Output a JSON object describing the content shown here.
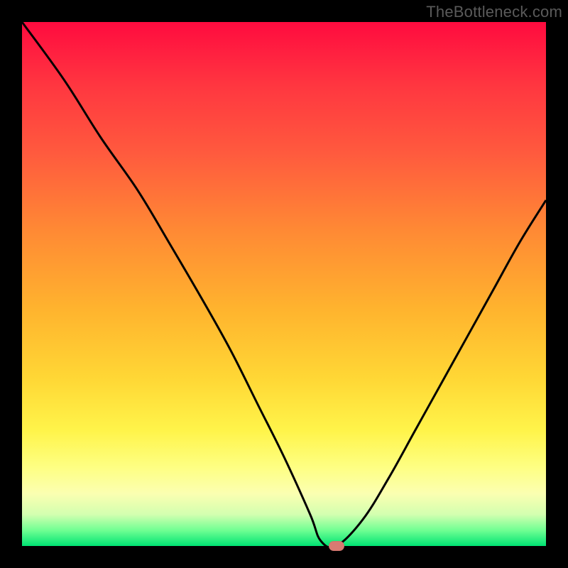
{
  "watermark": "TheBottleneck.com",
  "colors": {
    "curve_stroke": "#000000",
    "marker_fill": "#d97a72",
    "frame_bg": "#000000"
  },
  "chart_data": {
    "type": "line",
    "title": "",
    "xlabel": "",
    "ylabel": "",
    "xlim": [
      0,
      100
    ],
    "ylim": [
      0,
      100
    ],
    "series": [
      {
        "name": "bottleneck_curve",
        "x": [
          0,
          8,
          15,
          22,
          28,
          35,
          40,
          45,
          50,
          55,
          57,
          60,
          65,
          70,
          75,
          80,
          85,
          90,
          95,
          100
        ],
        "values": [
          100,
          89,
          78,
          68,
          58,
          46,
          37,
          27,
          17,
          6,
          1,
          0,
          5,
          13,
          22,
          31,
          40,
          49,
          58,
          66
        ]
      }
    ],
    "marker": {
      "x": 60,
      "y": 0
    },
    "gradient_stops": [
      {
        "pos": 0.0,
        "color": "#ff0b3f"
      },
      {
        "pos": 0.12,
        "color": "#ff3640"
      },
      {
        "pos": 0.25,
        "color": "#ff5a3e"
      },
      {
        "pos": 0.4,
        "color": "#ff8a34"
      },
      {
        "pos": 0.55,
        "color": "#ffb42e"
      },
      {
        "pos": 0.68,
        "color": "#ffd735"
      },
      {
        "pos": 0.78,
        "color": "#fff44a"
      },
      {
        "pos": 0.85,
        "color": "#feff83"
      },
      {
        "pos": 0.9,
        "color": "#fbffb1"
      },
      {
        "pos": 0.94,
        "color": "#d3ffb0"
      },
      {
        "pos": 0.97,
        "color": "#70ff93"
      },
      {
        "pos": 1.0,
        "color": "#00e373"
      }
    ]
  }
}
